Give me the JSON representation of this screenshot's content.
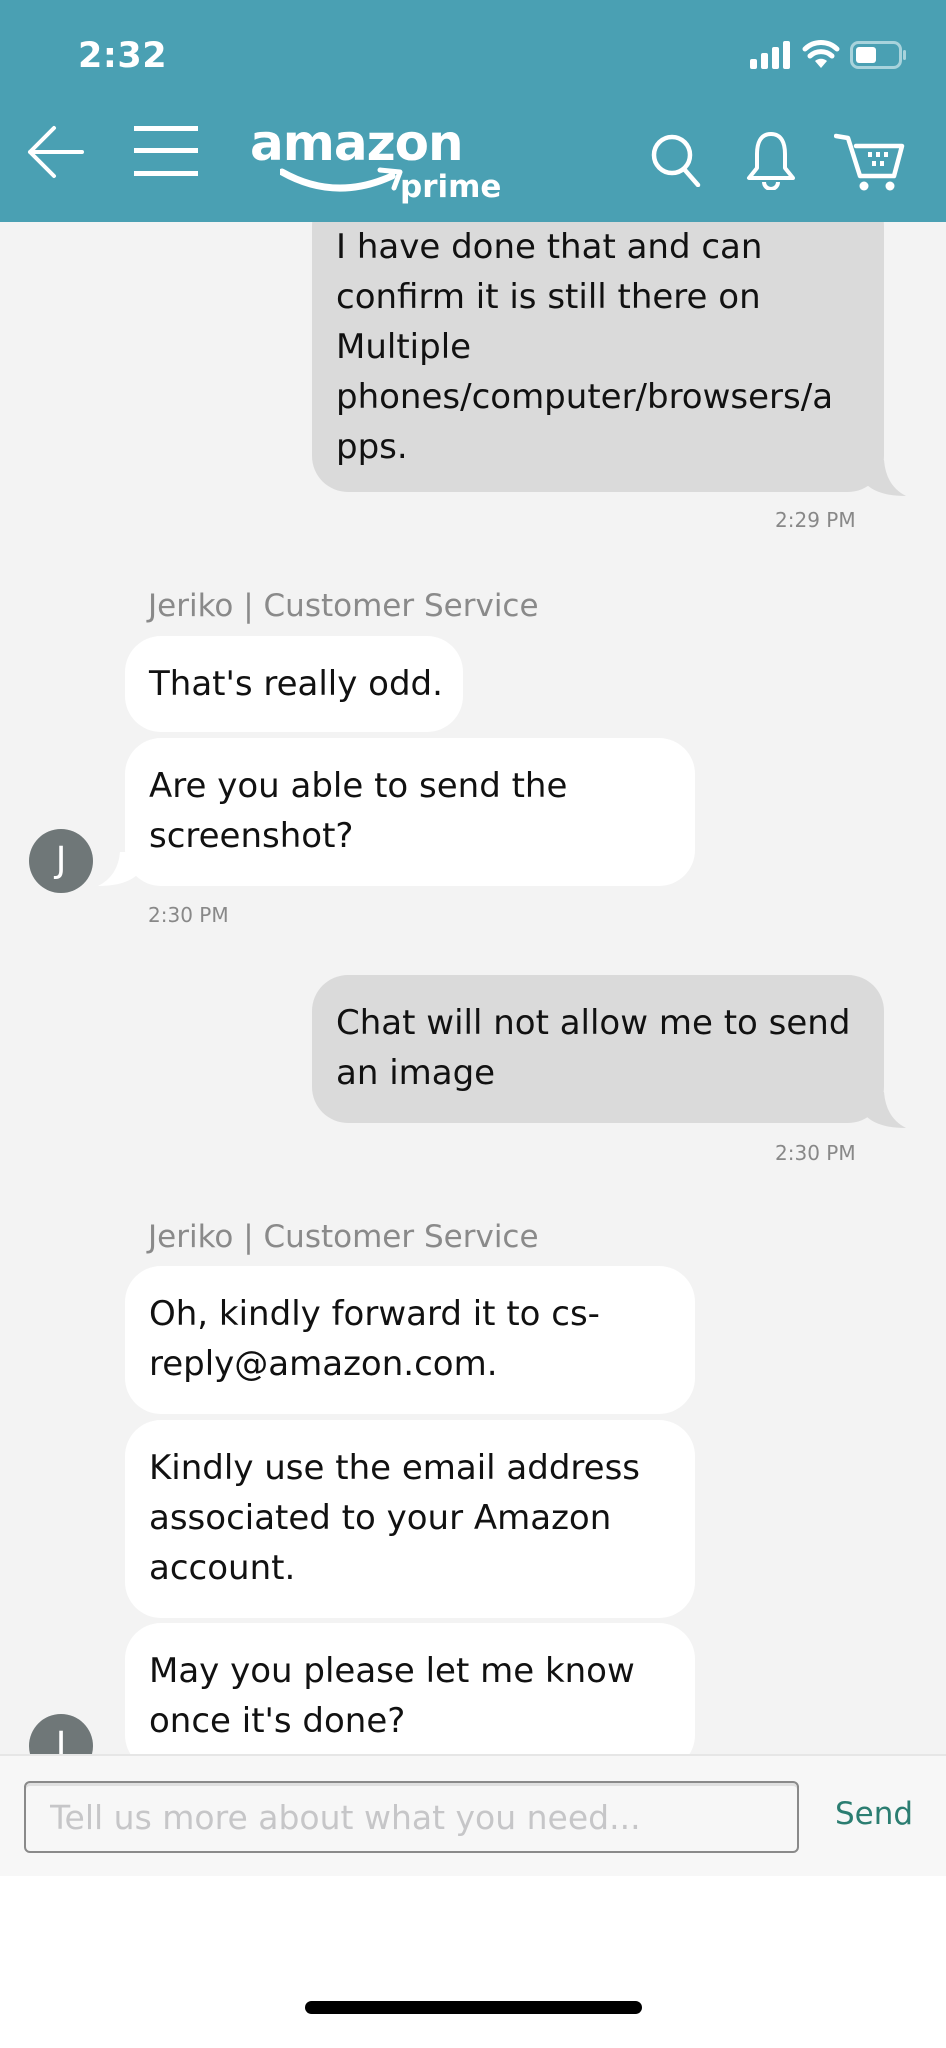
{
  "status_bar": {
    "time": "2:32",
    "icons": [
      "signal-icon",
      "wifi-icon",
      "battery-icon"
    ]
  },
  "header": {
    "logo_word": "amazon",
    "logo_sub": "prime",
    "left_icons": [
      "back-arrow-icon",
      "hamburger-menu-icon"
    ],
    "right_icons": [
      "search-icon",
      "bell-icon",
      "cart-icon"
    ]
  },
  "conversation": {
    "messages": [
      {
        "sender": "user",
        "text": "I have done that and can confirm it is still there on Multiple phones/computer/browsers/apps.",
        "lines": [
          "I have done that and can",
          "confirm it is still there on",
          "Multiple",
          "phones/computer/browsers/a",
          "pps."
        ],
        "timestamp": "2:29 PM"
      },
      {
        "sender": "agent",
        "agent_name": "Jeriko | Customer Service",
        "avatar_initial": "J",
        "bubbles": [
          {
            "lines": [
              "That's really odd."
            ]
          },
          {
            "lines": [
              "Are you able to send the",
              "screenshot?"
            ]
          }
        ],
        "timestamp": "2:30 PM"
      },
      {
        "sender": "user",
        "lines": [
          "Chat will not allow me to send",
          "an image"
        ],
        "timestamp": "2:30 PM"
      },
      {
        "sender": "agent",
        "agent_name": "Jeriko | Customer Service",
        "avatar_initial": "J",
        "bubbles": [
          {
            "lines": [
              "Oh, kindly forward it to cs-",
              "reply@amazon.com."
            ]
          },
          {
            "lines": [
              "Kindly use the email address",
              "associated to your Amazon",
              "account."
            ]
          },
          {
            "lines": [
              "May you please let me know",
              "once it's done?"
            ]
          }
        ]
      }
    ]
  },
  "composer": {
    "placeholder": "Tell us more about what you need...",
    "value": "",
    "send_label": "Send"
  },
  "colors": {
    "header_bg": "#4aa0b3",
    "chat_bg": "#f3f3f3",
    "user_bubble": "#dadada",
    "agent_bubble": "#ffffff",
    "send_text": "#2b7d71",
    "avatar_bg": "#6f7778"
  }
}
